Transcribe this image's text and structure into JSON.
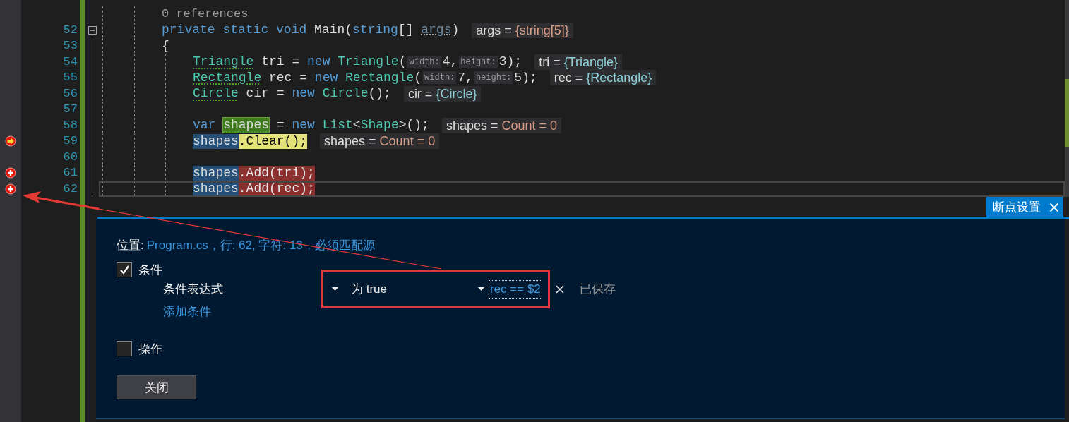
{
  "editor": {
    "lines": [
      {
        "kind": "codelens",
        "text": "0 references"
      },
      {
        "kind": "decl",
        "number": "52",
        "fold": true,
        "tokens": [
          {
            "text": "private static void",
            "kind": "keyword"
          },
          {
            "text": " Main(",
            "kind": "plain"
          },
          {
            "text": "string",
            "kind": "keyword"
          },
          {
            "text": "[] ",
            "kind": "plain"
          },
          {
            "text": "args",
            "kind": "unused"
          },
          {
            "text": ")",
            "kind": "plain"
          }
        ],
        "tip": {
          "name": "args =",
          "value": "{string[5]}",
          "color": "#d69d85"
        }
      },
      {
        "kind": "decl",
        "number": "53",
        "tokens": [
          {
            "text": "{",
            "kind": "plain"
          }
        ]
      },
      {
        "kind": "body",
        "number": "54",
        "tokens": [
          {
            "text": "Triangle",
            "kind": "type",
            "squiggle": true
          },
          {
            "text": " tri = ",
            "kind": "plain"
          },
          {
            "text": "new",
            "kind": "keyword"
          },
          {
            "text": " Triangle",
            "kind": "type"
          },
          {
            "text": "(",
            "kind": "plain"
          },
          {
            "text": "width:",
            "kind": "hint"
          },
          {
            "text": "4,",
            "kind": "plain"
          },
          {
            "text": "height:",
            "kind": "hint"
          },
          {
            "text": "3);",
            "kind": "plain"
          }
        ],
        "tip": {
          "name": "tri =",
          "value": "{Triangle}",
          "color": "#8fd0d8"
        }
      },
      {
        "kind": "body",
        "number": "55",
        "tokens": [
          {
            "text": "Rectangle",
            "kind": "type",
            "squiggle": true
          },
          {
            "text": " rec = ",
            "kind": "plain"
          },
          {
            "text": "new",
            "kind": "keyword"
          },
          {
            "text": " Rectangle",
            "kind": "type"
          },
          {
            "text": "(",
            "kind": "plain"
          },
          {
            "text": "width:",
            "kind": "hint"
          },
          {
            "text": "7,",
            "kind": "plain"
          },
          {
            "text": "height:",
            "kind": "hint"
          },
          {
            "text": "5);",
            "kind": "plain"
          }
        ],
        "tip": {
          "name": "rec =",
          "value": "{Rectangle}",
          "color": "#8fd0d8"
        }
      },
      {
        "kind": "body",
        "number": "56",
        "tokens": [
          {
            "text": "Circle",
            "kind": "type",
            "squiggle": true
          },
          {
            "text": " cir = ",
            "kind": "plain"
          },
          {
            "text": "new",
            "kind": "keyword"
          },
          {
            "text": " Circle",
            "kind": "type"
          },
          {
            "text": "();",
            "kind": "plain"
          }
        ],
        "tip": {
          "name": "cir =",
          "value": "{Circle}",
          "color": "#8fd0d8"
        }
      },
      {
        "kind": "body",
        "number": "57"
      },
      {
        "kind": "body",
        "number": "58",
        "tokens": [
          {
            "text": "var ",
            "kind": "keyword"
          },
          {
            "text": "shapes",
            "kind": "definition",
            "squiggle": true
          },
          {
            "text": " = ",
            "kind": "plain"
          },
          {
            "text": "new",
            "kind": "keyword"
          },
          {
            "text": " List",
            "kind": "type"
          },
          {
            "text": "<",
            "kind": "plain"
          },
          {
            "text": "Shape",
            "kind": "type"
          },
          {
            "text": ">();",
            "kind": "plain"
          }
        ],
        "tip": {
          "name": "shapes =",
          "value": "Count = 0",
          "color": "#d69d85"
        }
      },
      {
        "kind": "body",
        "number": "59",
        "breakpoint": true,
        "current_statement": true,
        "tokens": [
          {
            "text": "shapes",
            "kind": "reference"
          },
          {
            "text": ".Clear();",
            "kind": "current"
          }
        ],
        "tip": {
          "name": "shapes =",
          "value": "Count = 0",
          "color": "#d69d85"
        }
      },
      {
        "kind": "body",
        "number": "60"
      },
      {
        "kind": "body",
        "number": "61",
        "breakpoint": true,
        "current_statement": false,
        "tokens": [
          {
            "text": "shapes",
            "kind": "reference"
          },
          {
            "text": ".Add(tri);",
            "kind": "breakpoint"
          }
        ]
      },
      {
        "kind": "body",
        "number": "62",
        "breakpoint": true,
        "current_statement": false,
        "current_line": true,
        "tokens": [
          {
            "text": "shapes",
            "kind": "reference"
          },
          {
            "text": ".Add(rec);",
            "kind": "breakpoint"
          }
        ]
      }
    ]
  },
  "panel": {
    "tab": {
      "title": "断点设置"
    },
    "location": {
      "label": "位置:",
      "link": "Program.cs，行: 62, 字符: 13，必须匹配源"
    },
    "condition": {
      "label": "条件",
      "checked": true,
      "expression_label": "条件表达式",
      "mode": "为 true",
      "expression": "rec == $2",
      "status": "已保存",
      "add_link": "添加条件"
    },
    "action": {
      "label": "操作",
      "checked": false
    },
    "close_button": "关闭"
  }
}
